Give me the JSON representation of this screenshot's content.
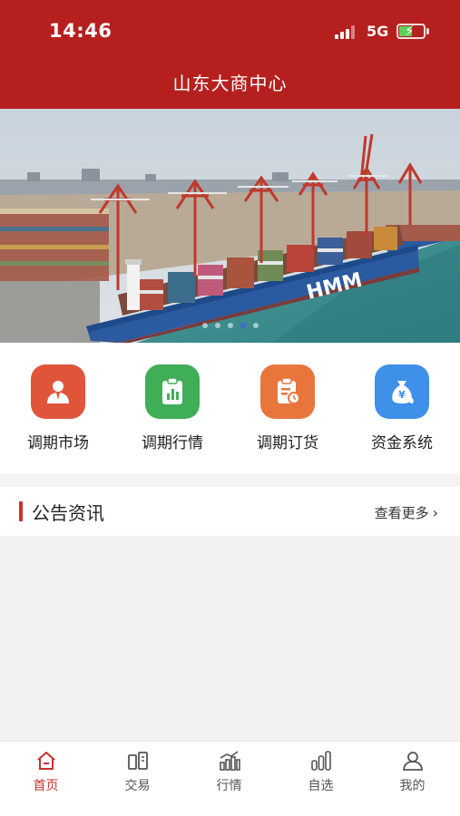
{
  "status_bar": {
    "time": "14:46",
    "network": "5G"
  },
  "header": {
    "title": "山东大商中心"
  },
  "banner": {
    "ship_lettering": "HMM",
    "active_slide": 4,
    "slide_count": 5
  },
  "quick_menu": [
    {
      "label": "调期市场",
      "color": "#e0553a",
      "icon": "person-icon"
    },
    {
      "label": "调期行情",
      "color": "#3fae57",
      "icon": "chart-clipboard-icon"
    },
    {
      "label": "调期订货",
      "color": "#e8763c",
      "icon": "order-clipboard-icon"
    },
    {
      "label": "资金系统",
      "color": "#3f90e8",
      "icon": "money-bag-icon"
    }
  ],
  "notice": {
    "title": "公告资讯",
    "more": "查看更多"
  },
  "tabs": [
    {
      "label": "首页",
      "icon": "home-icon",
      "active": true
    },
    {
      "label": "交易",
      "icon": "trade-icon",
      "active": false
    },
    {
      "label": "行情",
      "icon": "market-icon",
      "active": false
    },
    {
      "label": "自选",
      "icon": "watchlist-icon",
      "active": false
    },
    {
      "label": "我的",
      "icon": "profile-icon",
      "active": false
    }
  ],
  "colors": {
    "brand": "#b5201e",
    "accent": "#c8312e"
  }
}
